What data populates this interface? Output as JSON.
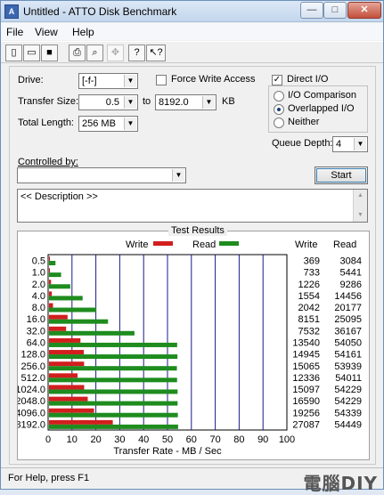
{
  "window": {
    "title": "Untitled - ATTO Disk Benchmark",
    "controls": {
      "minimize": "—",
      "maximize": "□",
      "close": "✕"
    }
  },
  "menu": [
    {
      "label": "File"
    },
    {
      "label": "View"
    },
    {
      "label": "Help"
    }
  ],
  "toolbar": {
    "buttons": [
      {
        "icon": "new-file-icon",
        "glyph": "▯"
      },
      {
        "icon": "open-folder-icon",
        "glyph": "▭"
      },
      {
        "icon": "save-icon",
        "glyph": "■"
      },
      {
        "icon": "print-icon",
        "glyph": "⎙"
      },
      {
        "icon": "print-preview-icon",
        "glyph": "⌕"
      },
      {
        "icon": "move-icon",
        "glyph": "✥"
      },
      {
        "icon": "about-icon",
        "glyph": "?"
      },
      {
        "icon": "context-help-icon",
        "glyph": "↖?"
      }
    ]
  },
  "settings": {
    "drive_label": "Drive:",
    "drive_value": "[-f-]",
    "force_write_access_label": "Force Write Access",
    "force_write_access_checked": false,
    "direct_io_label": "Direct I/O",
    "direct_io_checked": true,
    "transfer_size_label": "Transfer Size:",
    "transfer_size_from": "0.5",
    "transfer_size_to_label": "to",
    "transfer_size_to": "8192.0",
    "transfer_size_unit": "KB",
    "total_length_label": "Total Length:",
    "total_length_value": "256 MB",
    "io_modes": [
      {
        "label": "I/O Comparison",
        "selected": false
      },
      {
        "label": "Overlapped I/O",
        "selected": true
      },
      {
        "label": "Neither",
        "selected": false
      }
    ],
    "queue_depth_label": "Queue Depth:",
    "queue_depth_value": "4",
    "controlled_by_label": "Controlled by:",
    "controlled_by_value": "",
    "start_label": "Start",
    "description": "<< Description >>"
  },
  "results": {
    "group_title": "Test Results",
    "write_header": "Write",
    "read_header": "Read",
    "legend_write": "Write",
    "legend_read": "Read"
  },
  "chart_data": {
    "type": "bar",
    "orientation": "horizontal",
    "categories": [
      "0.5",
      "1.0",
      "2.0",
      "4.0",
      "8.0",
      "16.0",
      "32.0",
      "64.0",
      "128.0",
      "256.0",
      "512.0",
      "1024.0",
      "2048.0",
      "4096.0",
      "8192.0"
    ],
    "series": [
      {
        "name": "Write",
        "color": "#d21e1e",
        "values": [
          369,
          733,
          1226,
          1554,
          2042,
          8151,
          7532,
          13540,
          14945,
          15065,
          12336,
          15097,
          16590,
          19256,
          27087
        ]
      },
      {
        "name": "Read",
        "color": "#1e8c1e",
        "values": [
          3084,
          5441,
          9286,
          14456,
          20177,
          25095,
          36167,
          54050,
          54161,
          53939,
          54011,
          54229,
          54229,
          54339,
          54449
        ]
      }
    ],
    "xlabel": "Transfer Rate - MB / Sec",
    "xlim": [
      0,
      100
    ],
    "xticks": [
      "0",
      "10",
      "20",
      "30",
      "40",
      "50",
      "60",
      "70",
      "80",
      "90",
      "100"
    ],
    "units_per_tick": 10000,
    "grid": true,
    "legend_position": "top"
  },
  "status_bar": {
    "text": "For Help, press F1",
    "watermark": "電腦DIY"
  }
}
